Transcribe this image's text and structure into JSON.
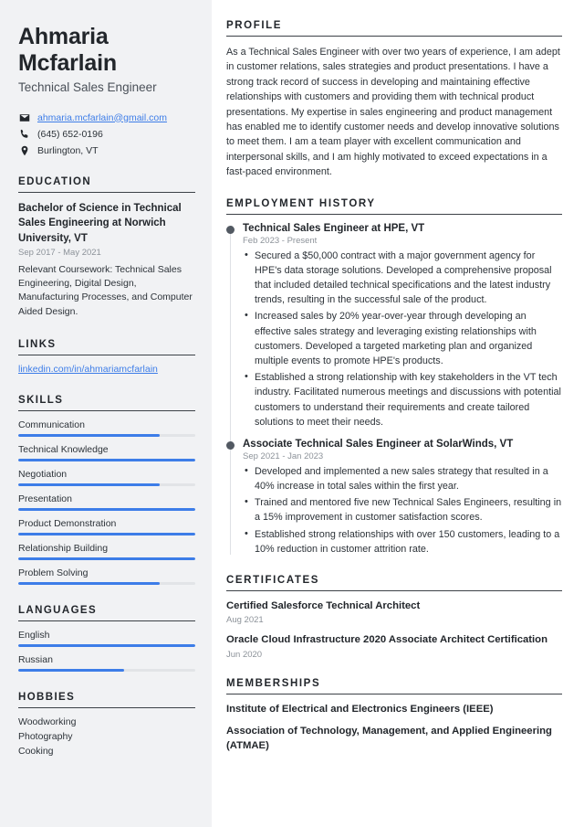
{
  "sidebar": {
    "name": "Ahmaria Mcfarlain",
    "job_title": "Technical Sales Engineer",
    "contacts": [
      {
        "icon": "envelope-icon",
        "text": "ahmaria.mcfarlain@gmail.com",
        "is_link": true
      },
      {
        "icon": "phone-icon",
        "text": "(645) 652-0196",
        "is_link": false
      },
      {
        "icon": "location-pin-icon",
        "text": "Burlington, VT",
        "is_link": false
      }
    ],
    "education": {
      "heading": "EDUCATION",
      "degree": "Bachelor of Science in Technical Sales Engineering at Norwich University, VT",
      "date": "Sep 2017 - May 2021",
      "description": "Relevant Coursework: Technical Sales Engineering, Digital Design, Manufacturing Processes, and Computer Aided Design."
    },
    "links": {
      "heading": "LINKS",
      "items": [
        {
          "label": "linkedin.com/in/ahmariamcfarlain"
        }
      ]
    },
    "skills": {
      "heading": "SKILLS",
      "items": [
        {
          "label": "Communication",
          "level": 80
        },
        {
          "label": "Technical Knowledge",
          "level": 100
        },
        {
          "label": "Negotiation",
          "level": 80
        },
        {
          "label": "Presentation",
          "level": 100
        },
        {
          "label": "Product Demonstration",
          "level": 100
        },
        {
          "label": "Relationship Building",
          "level": 100
        },
        {
          "label": "Problem Solving",
          "level": 80
        }
      ]
    },
    "languages": {
      "heading": "LANGUAGES",
      "items": [
        {
          "label": "English",
          "level": 100
        },
        {
          "label": "Russian",
          "level": 60
        }
      ]
    },
    "hobbies": {
      "heading": "HOBBIES",
      "items": [
        {
          "label": "Woodworking"
        },
        {
          "label": "Photography"
        },
        {
          "label": "Cooking"
        }
      ]
    }
  },
  "main": {
    "profile": {
      "heading": "PROFILE",
      "text": "As a Technical Sales Engineer with over two years of experience, I am adept in customer relations, sales strategies and product presentations. I have a strong track record of success in developing and maintaining effective relationships with customers and providing them with technical product presentations. My expertise in sales engineering and product management has enabled me to identify customer needs and develop innovative solutions to meet them. I am a team player with excellent communication and interpersonal skills, and I am highly motivated to exceed expectations in a fast-paced environment."
    },
    "employment": {
      "heading": "EMPLOYMENT HISTORY",
      "jobs": [
        {
          "title": "Technical Sales Engineer at HPE, VT",
          "date": "Feb 2023 - Present",
          "bullets": [
            "Secured a $50,000 contract with a major government agency for HPE's data storage solutions. Developed a comprehensive proposal that included detailed technical specifications and the latest industry trends, resulting in the successful sale of the product.",
            "Increased sales by 20% year-over-year through developing an effective sales strategy and leveraging existing relationships with customers. Developed a targeted marketing plan and organized multiple events to promote HPE's products.",
            "Established a strong relationship with key stakeholders in the VT tech industry. Facilitated numerous meetings and discussions with potential customers to understand their requirements and create tailored solutions to meet their needs."
          ]
        },
        {
          "title": "Associate Technical Sales Engineer at SolarWinds, VT",
          "date": "Sep 2021 - Jan 2023",
          "bullets": [
            "Developed and implemented a new sales strategy that resulted in a 40% increase in total sales within the first year.",
            "Trained and mentored five new Technical Sales Engineers, resulting in a 15% improvement in customer satisfaction scores.",
            "Established strong relationships with over 150 customers, leading to a 10% reduction in customer attrition rate."
          ]
        }
      ]
    },
    "certificates": {
      "heading": "CERTIFICATES",
      "items": [
        {
          "title": "Certified Salesforce Technical Architect",
          "date": "Aug 2021"
        },
        {
          "title": "Oracle Cloud Infrastructure 2020 Associate Architect Certification",
          "date": "Jun 2020"
        }
      ]
    },
    "memberships": {
      "heading": "MEMBERSHIPS",
      "items": [
        {
          "title": "Institute of Electrical and Electronics Engineers (IEEE)"
        },
        {
          "title": "Association of Technology, Management, and Applied Engineering (ATMAE)"
        }
      ]
    }
  },
  "colors": {
    "accent": "#3d7de8",
    "sidebar_bg": "#f1f2f4",
    "text": "#2c3238",
    "muted": "#8c9299"
  }
}
